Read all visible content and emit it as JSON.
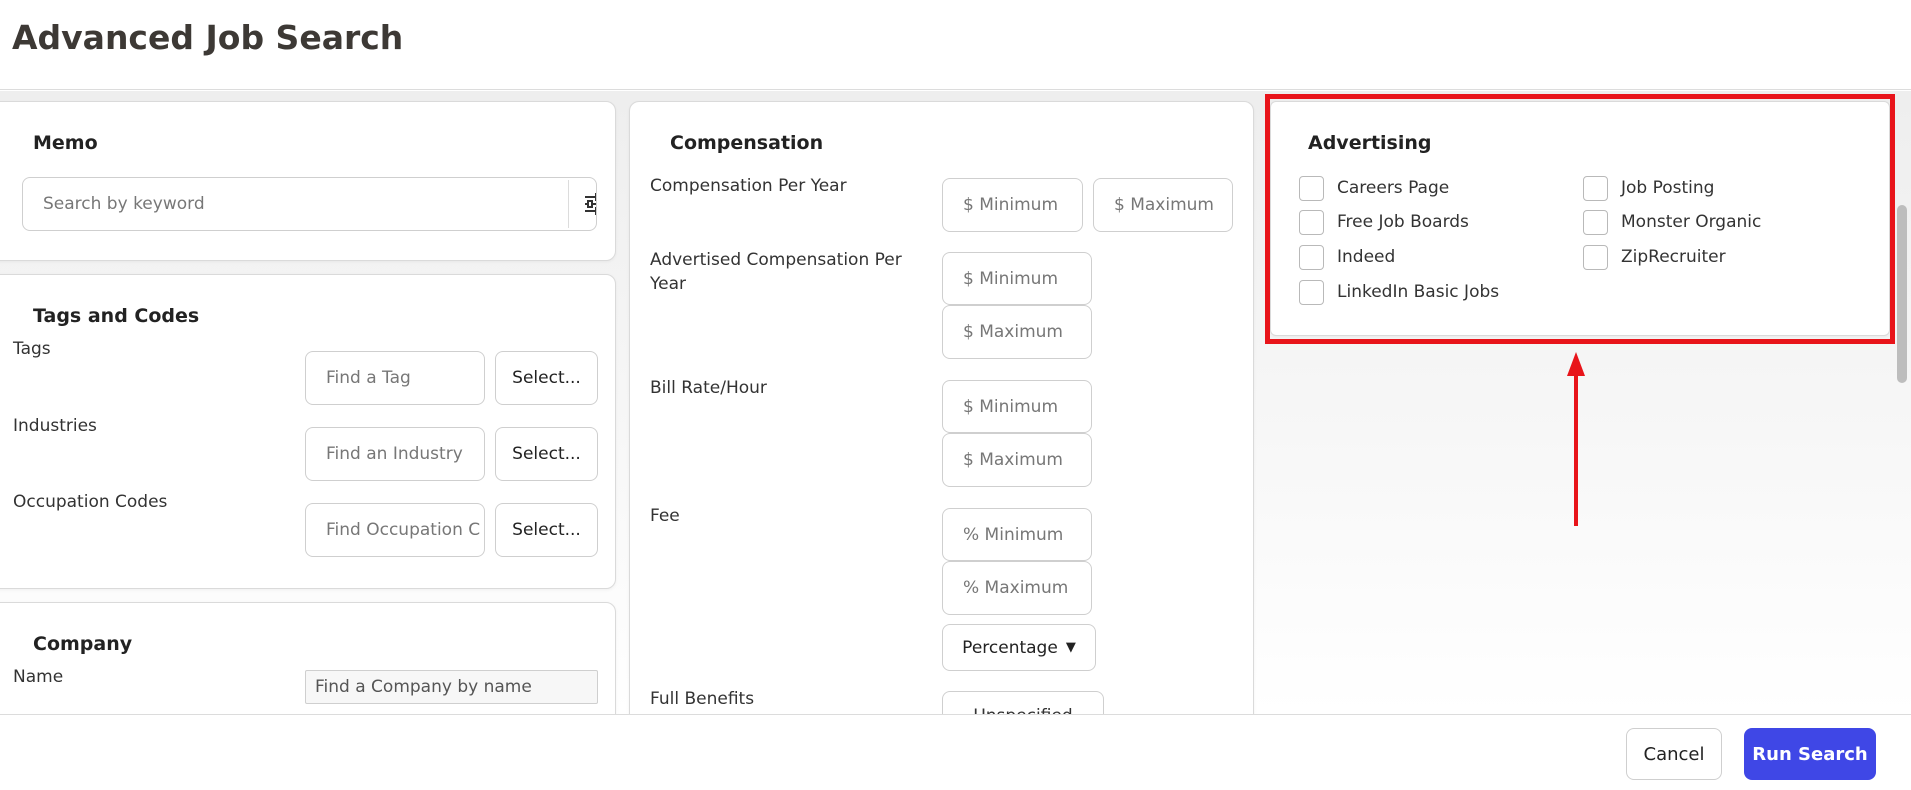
{
  "page": {
    "title": "Advanced Job Search"
  },
  "memo": {
    "title": "Memo",
    "search_placeholder": "Search by keyword"
  },
  "tags_codes": {
    "title": "Tags and Codes",
    "rows": [
      {
        "label": "Tags",
        "placeholder": "Find a Tag",
        "button": "Select..."
      },
      {
        "label": "Industries",
        "placeholder": "Find an Industry",
        "button": "Select..."
      },
      {
        "label": "Occupation Codes",
        "placeholder": "Find Occupation C",
        "button": "Select..."
      }
    ]
  },
  "company": {
    "title": "Company",
    "name_label": "Name",
    "name_placeholder": "Find a Company by name"
  },
  "compensation": {
    "title": "Compensation",
    "per_year_label": "Compensation Per Year",
    "per_year_min": "$ Minimum",
    "per_year_max": "$ Maximum",
    "advertised_label": "Advertised Compensation Per Year",
    "advertised_min": "$ Minimum",
    "advertised_max": "$ Maximum",
    "bill_rate_label": "Bill Rate/Hour",
    "bill_rate_min": "$ Minimum",
    "bill_rate_max": "$ Maximum",
    "fee_label": "Fee",
    "fee_min": "% Minimum",
    "fee_max": "% Maximum",
    "fee_type": "Percentage",
    "benefits_label": "Full Benefits",
    "benefits_value": "Unspecified"
  },
  "advertising": {
    "title": "Advertising",
    "options": [
      {
        "label": "Careers Page",
        "checked": false
      },
      {
        "label": "Job Posting",
        "checked": false
      },
      {
        "label": "Free Job Boards",
        "checked": false
      },
      {
        "label": "Monster Organic",
        "checked": false
      },
      {
        "label": "Indeed",
        "checked": false
      },
      {
        "label": "ZipRecruiter",
        "checked": false
      },
      {
        "label": "LinkedIn Basic Jobs",
        "checked": false
      }
    ]
  },
  "footer": {
    "cancel": "Cancel",
    "run": "Run Search"
  },
  "colors": {
    "accent": "#3f47e6",
    "highlight": "#e8141a"
  },
  "icons": {
    "filter": "sliders-icon",
    "caret": "chevron-down-icon",
    "annotation": "arrow-up-icon"
  }
}
